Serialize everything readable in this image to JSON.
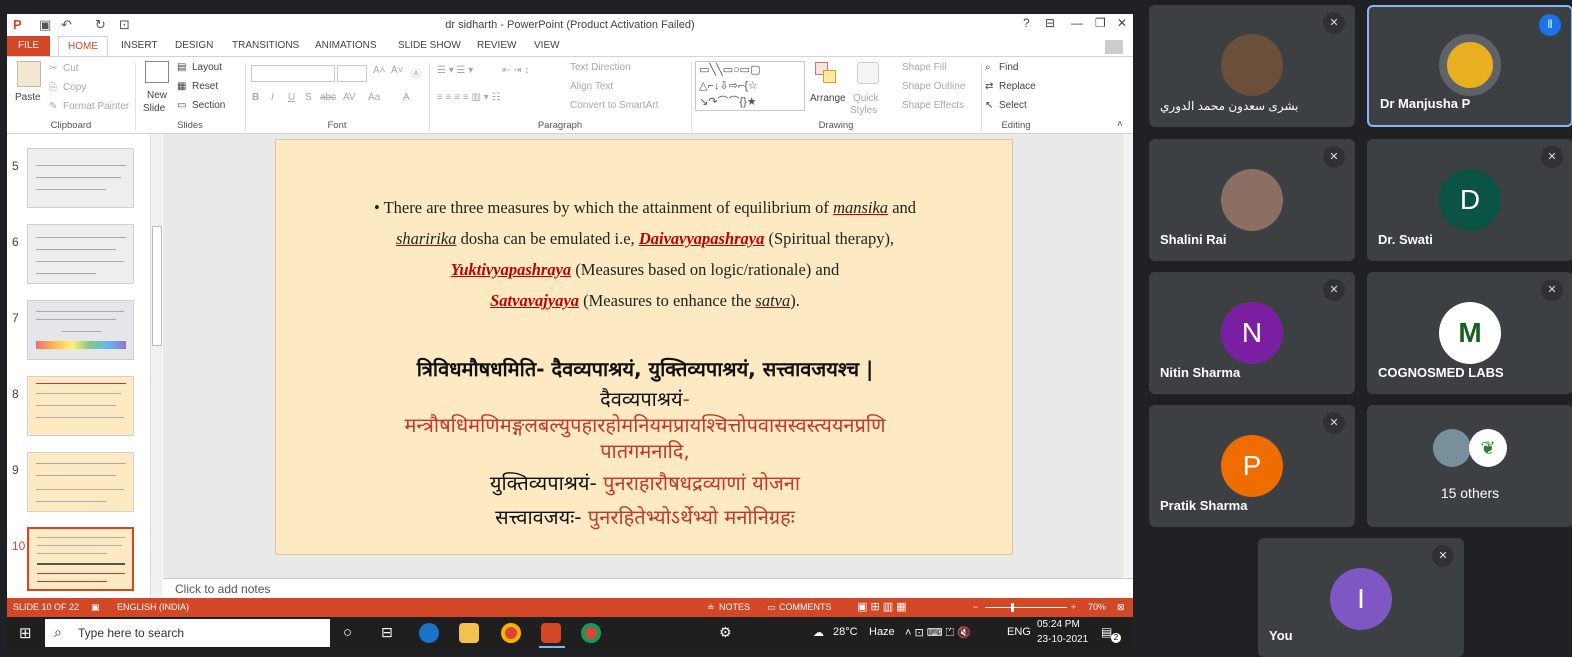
{
  "window": {
    "title": "dr sidharth - PowerPoint (Product Activation Failed)"
  },
  "tabs": [
    "FILE",
    "HOME",
    "INSERT",
    "DESIGN",
    "TRANSITIONS",
    "ANIMATIONS",
    "SLIDE SHOW",
    "REVIEW",
    "VIEW"
  ],
  "ribbon": {
    "clipboard": {
      "paste": "Paste",
      "cut": "Cut",
      "copy": "Copy",
      "format_painter": "Format Painter",
      "group": "Clipboard"
    },
    "slides": {
      "new_slide": "New",
      "new_slide2": "Slide",
      "layout": "Layout",
      "reset": "Reset",
      "section": "Section",
      "group": "Slides"
    },
    "font": {
      "group": "Font",
      "bold": "B",
      "italic": "I",
      "underline": "U",
      "strike": "S",
      "shadow": "abc",
      "spacing": "AV",
      "case": "Aa",
      "color": "A"
    },
    "paragraph": {
      "text_direction": "Text Direction",
      "align_text": "Align Text",
      "smartart": "Convert to SmartArt",
      "group": "Paragraph"
    },
    "drawing": {
      "arrange": "Arrange",
      "quick": "Quick",
      "styles": "Styles",
      "fill": "Shape Fill",
      "outline": "Shape Outline",
      "effects": "Shape Effects",
      "group": "Drawing"
    },
    "editing": {
      "find": "Find",
      "replace": "Replace",
      "select": "Select",
      "group": "Editing"
    }
  },
  "thumbnails": [
    {
      "num": "5"
    },
    {
      "num": "6"
    },
    {
      "num": "7"
    },
    {
      "num": "8"
    },
    {
      "num": "9"
    },
    {
      "num": "10"
    }
  ],
  "slide": {
    "bullet": "•",
    "l1a": "There are three measures by which the attainment of equilibrium of ",
    "mansika": "mansika",
    "l1b": " and",
    "sharirika": "sharirika",
    "l2a": " dosha can be emulated i.e, ",
    "daivav": "Daivavyapashraya",
    "l2b": " (Spiritual therapy),",
    "yukti": "Yuktivyapashraya",
    "l3b": " (Measures based on logic/rationale) and",
    "satva": "Satvavajyaya",
    "l4b": " (Measures to enhance the ",
    "satva_i": "satva",
    "l4c": ").",
    "s1": "त्रिविधमौषधमिति- दैवव्यपाश्रयं, युक्तिव्यपाश्रयं, सत्त्वावजयश्च |",
    "s2a": "दैवव्यपाश्रयं",
    "s2b": "-",
    "s3": "मन्त्रौषधिमणिमङ्गलबल्युपहारहोमनियमप्रायश्चित्तोपवासस्वस्त्ययनप्रणि",
    "s4": "पातगमनादि,",
    "s5a": "युक्तिव्यपाश्रयं- ",
    "s5b": "पुनराहारौषधद्रव्याणां योजना",
    "s6a": "सत्त्वावजयः- ",
    "s6b": "पुनरहितेभ्योऽर्थेभ्यो मनोनिग्रहः"
  },
  "notes_placeholder": "Click to add notes",
  "status": {
    "slide": "SLIDE 10 OF 22",
    "lang": "ENGLISH (INDIA)",
    "notes": "NOTES",
    "comments": "COMMENTS",
    "zoom": "70%"
  },
  "taskbar": {
    "search": "Type here to search",
    "weather": "28°C",
    "haze": "Haze",
    "lang": "ENG",
    "time": "05:24 PM",
    "date": "23-10-2021",
    "notif": "2"
  },
  "participants": [
    {
      "name": "بشرى سعدون محمد الدوري",
      "initial": "",
      "color": "#6b4f3a"
    },
    {
      "name": "Dr Manjusha P",
      "initial": "",
      "color": "#e8b020"
    },
    {
      "name": "Shalini Rai",
      "initial": "",
      "color": "#8d6e63"
    },
    {
      "name": "Dr. Swati",
      "initial": "D",
      "color": "#0b5345"
    },
    {
      "name": "Nitin Sharma",
      "initial": "N",
      "color": "#7b1fa2"
    },
    {
      "name": "COGNOSMED LABS",
      "initial": "M",
      "color": "#ffffff"
    },
    {
      "name": "Pratik Sharma",
      "initial": "P",
      "color": "#ef6c00"
    },
    {
      "name": "15 others",
      "initial": "",
      "color": "#3c4043"
    },
    {
      "name": "You",
      "initial": "I",
      "color": "#7e57c2"
    }
  ],
  "colors": {
    "ppt_accent": "#d24726",
    "meet_bg": "#202124",
    "tile": "#3c4043",
    "active_border": "#8ab4f8"
  }
}
